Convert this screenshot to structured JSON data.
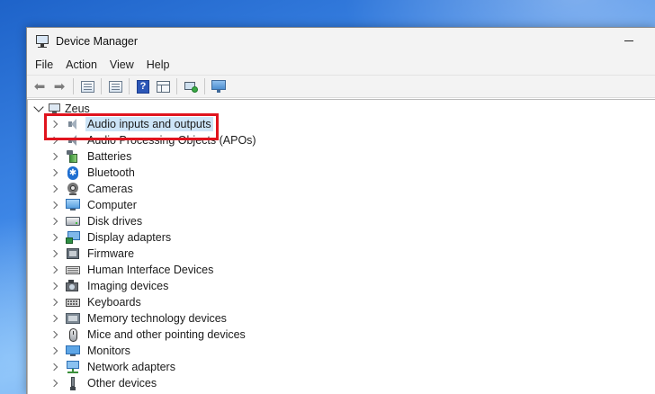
{
  "window": {
    "title": "Device Manager"
  },
  "menu": [
    {
      "label": "File"
    },
    {
      "label": "Action"
    },
    {
      "label": "View"
    },
    {
      "label": "Help"
    }
  ],
  "toolbar": {
    "icons": [
      "back-arrow-icon",
      "forward-arrow-icon",
      "properties-icon",
      "update-driver-icon",
      "help-icon",
      "show-hidden-icon",
      "scan-hardware-icon",
      "monitor-icon"
    ]
  },
  "tree": {
    "root": {
      "label": "Zeus",
      "expanded": true
    },
    "items": [
      {
        "label": "Audio inputs and outputs",
        "icon": "speaker-icon",
        "selected": true
      },
      {
        "label": "Audio Processing Objects (APOs)",
        "icon": "apo-speaker-icon"
      },
      {
        "label": "Batteries",
        "icon": "battery-icon"
      },
      {
        "label": "Bluetooth",
        "icon": "bluetooth-icon"
      },
      {
        "label": "Cameras",
        "icon": "camera-icon"
      },
      {
        "label": "Computer",
        "icon": "computer-icon"
      },
      {
        "label": "Disk drives",
        "icon": "disk-drive-icon"
      },
      {
        "label": "Display adapters",
        "icon": "display-adapter-icon"
      },
      {
        "label": "Firmware",
        "icon": "firmware-icon"
      },
      {
        "label": "Human Interface Devices",
        "icon": "hid-icon"
      },
      {
        "label": "Imaging devices",
        "icon": "imaging-device-icon"
      },
      {
        "label": "Keyboards",
        "icon": "keyboard-icon"
      },
      {
        "label": "Memory technology devices",
        "icon": "memory-icon"
      },
      {
        "label": "Mice and other pointing devices",
        "icon": "mouse-icon"
      },
      {
        "label": "Monitors",
        "icon": "monitors-icon"
      },
      {
        "label": "Network adapters",
        "icon": "network-adapter-icon"
      },
      {
        "label": "Other devices",
        "icon": "other-devices-icon"
      }
    ]
  },
  "colors": {
    "selection": "#cce4f7",
    "highlight_border": "#e0141e",
    "chrome": "#f3f3f3"
  }
}
